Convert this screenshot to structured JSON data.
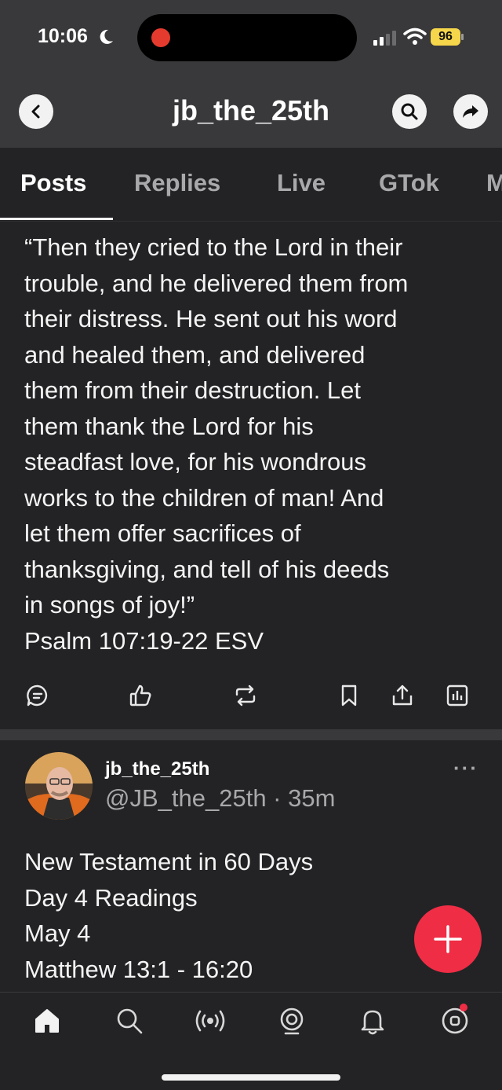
{
  "status_bar": {
    "time": "10:06",
    "battery": "96",
    "battery_color": "#f6d64a",
    "recording_dot_color": "#e53b2f"
  },
  "header": {
    "title": "jb_the_25th",
    "back_icon": "chevron-left-icon",
    "search_icon": "search-icon",
    "share_icon": "share-arrow-icon"
  },
  "tabs": [
    {
      "label": "Posts",
      "active": true
    },
    {
      "label": "Replies",
      "active": false
    },
    {
      "label": "Live",
      "active": false
    },
    {
      "label": "GTok",
      "active": false
    },
    {
      "label": "M",
      "active": false
    }
  ],
  "post1": {
    "text": "“Then they cried to the Lord in their\ntrouble, and he delivered them from\ntheir distress. He sent out his word\nand healed them, and delivered\nthem from their destruction. Let\nthem thank the Lord for his\nsteadfast love, for his wondrous\nworks to the children of man! And\nlet them offer sacrifices of\nthanksgiving, and tell of his deeds\nin songs of joy!”\nPsalm 107:19-22 ESV",
    "actions": [
      "reply-icon",
      "like-icon",
      "repost-icon",
      "bookmark-icon",
      "share-icon",
      "analytics-icon"
    ]
  },
  "post2": {
    "author_name": "jb_the_25th",
    "author_handle": "@JB_the_25th · 35m",
    "more_label": "···",
    "text": "New Testament in 60 Days\nDay 4 Readings\nMay 4\nMatthew 13:1 - 16:20"
  },
  "fab": {
    "icon": "plus-icon",
    "color": "#ef2d45"
  },
  "bottom_nav": [
    "home-icon",
    "search-icon",
    "live-broadcast-icon",
    "gtok-icon",
    "notifications-bell-icon",
    "profile-icon"
  ],
  "colors": {
    "background": "#232325",
    "header": "#39393b",
    "accent": "#ef2d45"
  }
}
